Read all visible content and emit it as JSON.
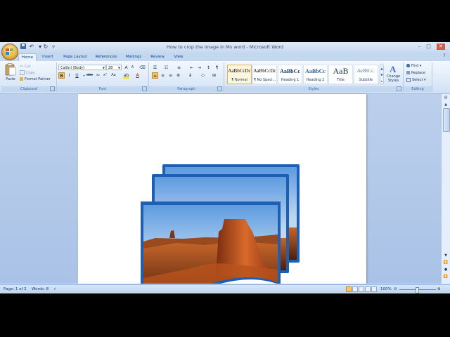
{
  "window": {
    "title": "How to crop the image in Ms word - Microsoft Word",
    "controls": [
      "–",
      "□",
      "✕"
    ]
  },
  "quick_access": {
    "icons": [
      "save-icon",
      "undo-icon",
      "redo-icon",
      "customize-icon"
    ]
  },
  "tabs": [
    "Home",
    "Insert",
    "Page Layout",
    "References",
    "Mailings",
    "Review",
    "View"
  ],
  "active_tab": "Home",
  "ribbon": {
    "clipboard": {
      "label": "Clipboard",
      "paste": "Paste",
      "cut": "Cut",
      "copy": "Copy",
      "format_painter": "Format Painter"
    },
    "font": {
      "label": "Font",
      "font_name": "Calibri (Body)",
      "font_size": "28"
    },
    "paragraph": {
      "label": "Paragraph"
    },
    "styles": {
      "label": "Styles",
      "items": [
        {
          "sample": "AaBbCcDc",
          "name": "¶ Normal",
          "selected": true
        },
        {
          "sample": "AaBbCcDc",
          "name": "¶ No Spaci...",
          "selected": false
        },
        {
          "sample": "AaBbCc",
          "name": "Heading 1",
          "selected": false
        },
        {
          "sample": "AaBbCc",
          "name": "Heading 2",
          "selected": false
        },
        {
          "sample": "AaB",
          "name": "Title",
          "selected": false
        },
        {
          "sample": "AaBbCc.",
          "name": "Subtitle",
          "selected": false
        }
      ],
      "change_styles": "Change Styles"
    },
    "editing": {
      "label": "Editing",
      "find": "Find",
      "replace": "Replace",
      "select": "Select"
    }
  },
  "status": {
    "page": "Page: 1 of 2",
    "words": "Words: 8",
    "zoom": "100%"
  },
  "colors": {
    "frame_blue": "#1d5fb5",
    "ribbon_text": "#15428b",
    "selected_style": "#e7b04a"
  }
}
